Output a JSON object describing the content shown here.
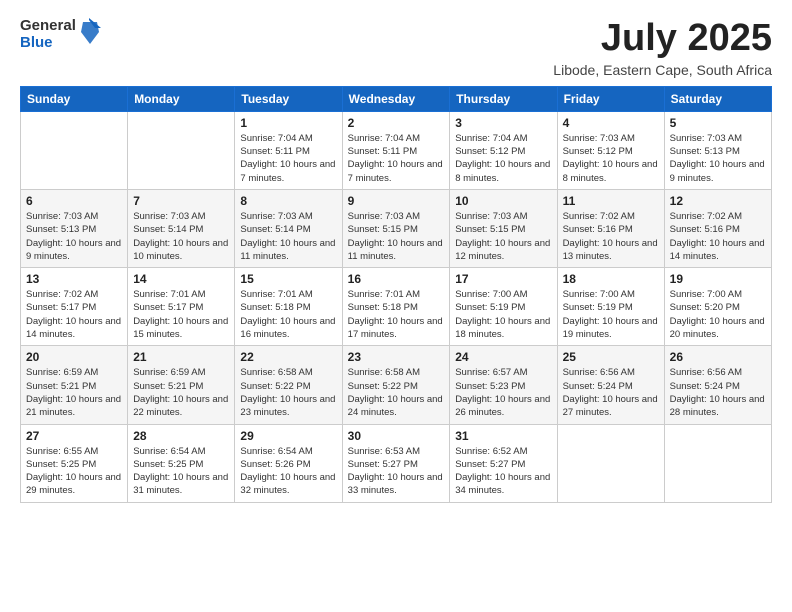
{
  "header": {
    "logo_general": "General",
    "logo_blue": "Blue",
    "title": "July 2025",
    "subtitle": "Libode, Eastern Cape, South Africa"
  },
  "weekdays": [
    "Sunday",
    "Monday",
    "Tuesday",
    "Wednesday",
    "Thursday",
    "Friday",
    "Saturday"
  ],
  "weeks": [
    [
      {
        "day": "",
        "info": ""
      },
      {
        "day": "",
        "info": ""
      },
      {
        "day": "1",
        "info": "Sunrise: 7:04 AM\nSunset: 5:11 PM\nDaylight: 10 hours and 7 minutes."
      },
      {
        "day": "2",
        "info": "Sunrise: 7:04 AM\nSunset: 5:11 PM\nDaylight: 10 hours and 7 minutes."
      },
      {
        "day": "3",
        "info": "Sunrise: 7:04 AM\nSunset: 5:12 PM\nDaylight: 10 hours and 8 minutes."
      },
      {
        "day": "4",
        "info": "Sunrise: 7:03 AM\nSunset: 5:12 PM\nDaylight: 10 hours and 8 minutes."
      },
      {
        "day": "5",
        "info": "Sunrise: 7:03 AM\nSunset: 5:13 PM\nDaylight: 10 hours and 9 minutes."
      }
    ],
    [
      {
        "day": "6",
        "info": "Sunrise: 7:03 AM\nSunset: 5:13 PM\nDaylight: 10 hours and 9 minutes."
      },
      {
        "day": "7",
        "info": "Sunrise: 7:03 AM\nSunset: 5:14 PM\nDaylight: 10 hours and 10 minutes."
      },
      {
        "day": "8",
        "info": "Sunrise: 7:03 AM\nSunset: 5:14 PM\nDaylight: 10 hours and 11 minutes."
      },
      {
        "day": "9",
        "info": "Sunrise: 7:03 AM\nSunset: 5:15 PM\nDaylight: 10 hours and 11 minutes."
      },
      {
        "day": "10",
        "info": "Sunrise: 7:03 AM\nSunset: 5:15 PM\nDaylight: 10 hours and 12 minutes."
      },
      {
        "day": "11",
        "info": "Sunrise: 7:02 AM\nSunset: 5:16 PM\nDaylight: 10 hours and 13 minutes."
      },
      {
        "day": "12",
        "info": "Sunrise: 7:02 AM\nSunset: 5:16 PM\nDaylight: 10 hours and 14 minutes."
      }
    ],
    [
      {
        "day": "13",
        "info": "Sunrise: 7:02 AM\nSunset: 5:17 PM\nDaylight: 10 hours and 14 minutes."
      },
      {
        "day": "14",
        "info": "Sunrise: 7:01 AM\nSunset: 5:17 PM\nDaylight: 10 hours and 15 minutes."
      },
      {
        "day": "15",
        "info": "Sunrise: 7:01 AM\nSunset: 5:18 PM\nDaylight: 10 hours and 16 minutes."
      },
      {
        "day": "16",
        "info": "Sunrise: 7:01 AM\nSunset: 5:18 PM\nDaylight: 10 hours and 17 minutes."
      },
      {
        "day": "17",
        "info": "Sunrise: 7:00 AM\nSunset: 5:19 PM\nDaylight: 10 hours and 18 minutes."
      },
      {
        "day": "18",
        "info": "Sunrise: 7:00 AM\nSunset: 5:19 PM\nDaylight: 10 hours and 19 minutes."
      },
      {
        "day": "19",
        "info": "Sunrise: 7:00 AM\nSunset: 5:20 PM\nDaylight: 10 hours and 20 minutes."
      }
    ],
    [
      {
        "day": "20",
        "info": "Sunrise: 6:59 AM\nSunset: 5:21 PM\nDaylight: 10 hours and 21 minutes."
      },
      {
        "day": "21",
        "info": "Sunrise: 6:59 AM\nSunset: 5:21 PM\nDaylight: 10 hours and 22 minutes."
      },
      {
        "day": "22",
        "info": "Sunrise: 6:58 AM\nSunset: 5:22 PM\nDaylight: 10 hours and 23 minutes."
      },
      {
        "day": "23",
        "info": "Sunrise: 6:58 AM\nSunset: 5:22 PM\nDaylight: 10 hours and 24 minutes."
      },
      {
        "day": "24",
        "info": "Sunrise: 6:57 AM\nSunset: 5:23 PM\nDaylight: 10 hours and 26 minutes."
      },
      {
        "day": "25",
        "info": "Sunrise: 6:56 AM\nSunset: 5:24 PM\nDaylight: 10 hours and 27 minutes."
      },
      {
        "day": "26",
        "info": "Sunrise: 6:56 AM\nSunset: 5:24 PM\nDaylight: 10 hours and 28 minutes."
      }
    ],
    [
      {
        "day": "27",
        "info": "Sunrise: 6:55 AM\nSunset: 5:25 PM\nDaylight: 10 hours and 29 minutes."
      },
      {
        "day": "28",
        "info": "Sunrise: 6:54 AM\nSunset: 5:25 PM\nDaylight: 10 hours and 31 minutes."
      },
      {
        "day": "29",
        "info": "Sunrise: 6:54 AM\nSunset: 5:26 PM\nDaylight: 10 hours and 32 minutes."
      },
      {
        "day": "30",
        "info": "Sunrise: 6:53 AM\nSunset: 5:27 PM\nDaylight: 10 hours and 33 minutes."
      },
      {
        "day": "31",
        "info": "Sunrise: 6:52 AM\nSunset: 5:27 PM\nDaylight: 10 hours and 34 minutes."
      },
      {
        "day": "",
        "info": ""
      },
      {
        "day": "",
        "info": ""
      }
    ]
  ]
}
